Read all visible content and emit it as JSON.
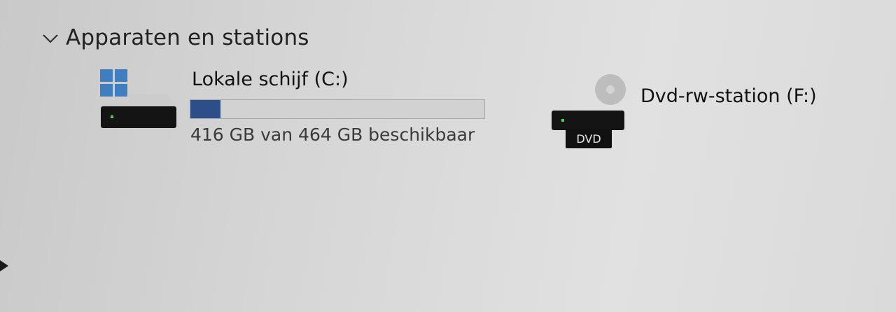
{
  "section": {
    "title": "Apparaten en stations",
    "expanded": true,
    "chevron_icon": "chevron-down-icon"
  },
  "drives": {
    "c": {
      "name": "Lokale schijf (C:)",
      "free_text": "416 GB van 464 GB beschikbaar",
      "used_fraction": 0.1034,
      "icon": "windows-drive-icon",
      "bar_color": "#2c4f8a"
    },
    "f": {
      "name": "Dvd-rw-station (F:)",
      "badge": "DVD",
      "icon": "dvd-drive-icon"
    }
  }
}
